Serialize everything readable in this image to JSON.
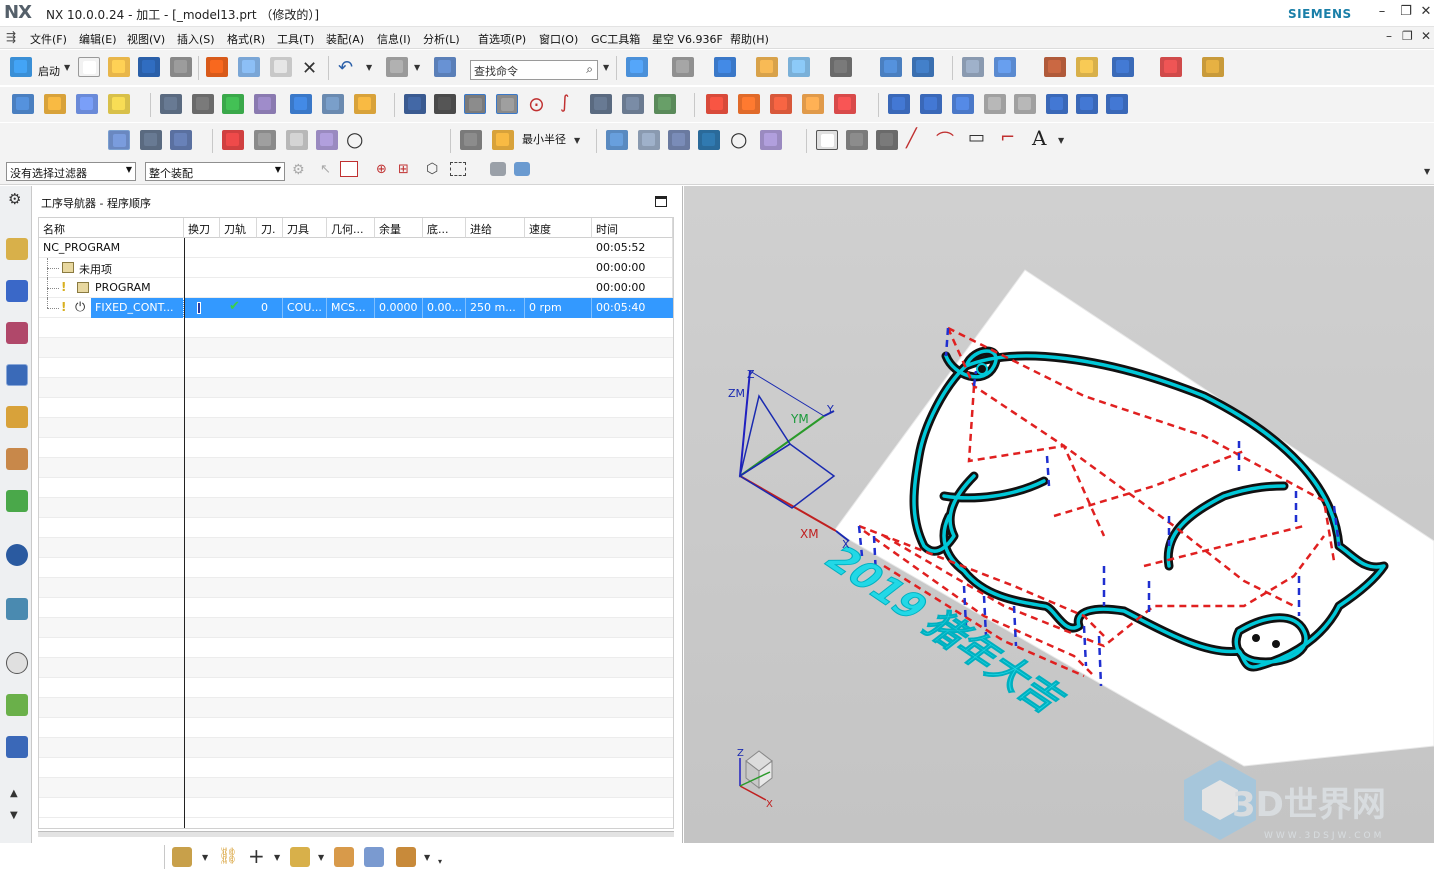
{
  "titlebar": {
    "logo": "NX",
    "title": "NX 10.0.0.24 - 加工 - [_model13.prt （修改的）]",
    "brand": "SIEMENS"
  },
  "menubar": {
    "items": [
      "文件(F)",
      "编辑(E)",
      "视图(V)",
      "插入(S)",
      "格式(R)",
      "工具(T)",
      "装配(A)",
      "信息(I)",
      "分析(L)",
      "首选项(P)",
      "窗口(O)",
      "GC工具箱",
      "星空 V6.936F",
      "帮助(H)"
    ]
  },
  "toolbar": {
    "start_label": "启动",
    "command_search_placeholder": "查找命令",
    "min_radius_label": "最小半径"
  },
  "selection_bar": {
    "filter_value": "没有选择过滤器",
    "scope_value": "整个装配"
  },
  "navigator": {
    "title": "工序导航器 - 程序顺序",
    "columns": [
      "名称",
      "换刀",
      "刀轨",
      "刀.",
      "刀具",
      "几何...",
      "余量",
      "底...",
      "进给",
      "速度",
      "时间"
    ],
    "rows": [
      {
        "name": "NC_PROGRAM",
        "time": "00:05:52"
      },
      {
        "name": "未用项",
        "time": "00:00:00"
      },
      {
        "name": "PROGRAM",
        "time": "00:00:00"
      },
      {
        "name": "FIXED_CONT...",
        "tool_num": "0",
        "tool": "COU...",
        "geometry": "MCS...",
        "stock": "0.0000",
        "floor": "0.00...",
        "feed": "250 m...",
        "speed": "0 rpm",
        "time": "00:05:40"
      }
    ]
  },
  "viewport": {
    "text_3d": "2019 猪年大吉",
    "axis_labels": {
      "z": "Z",
      "zm": "ZM",
      "ym": "YM",
      "y": "Y",
      "xm": "XM",
      "x": "X"
    },
    "mini_triad": {
      "z": "Z",
      "x": "X"
    },
    "watermark": "3D世界网",
    "watermark_url": "WWW.3DSJW.COM"
  },
  "colors": {
    "accent": "#3399ff",
    "toolpath_cut": "#00c8d8",
    "toolpath_rapid": "#e02020",
    "toolpath_engage": "#1f2fd0",
    "brand": "#1a7fa8"
  }
}
